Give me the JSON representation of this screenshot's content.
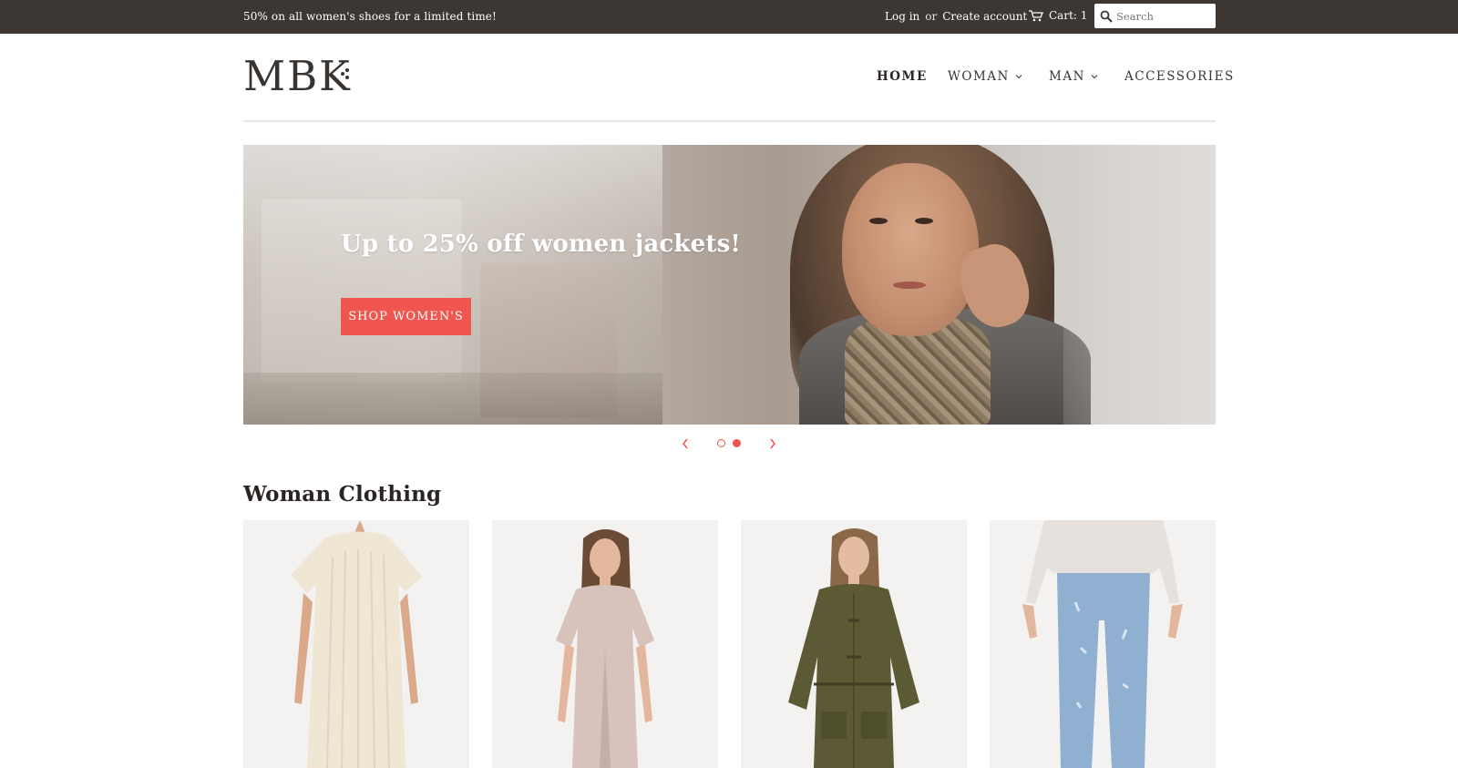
{
  "topbar": {
    "announcement": "50% on all women's shoes for a limited time!",
    "login": "Log in",
    "or": "or",
    "create_account": "Create account",
    "cart": "Cart: 1",
    "search_placeholder": "Search"
  },
  "header": {
    "logo": "MBK",
    "nav": [
      {
        "label": "HOME",
        "active": true
      },
      {
        "label": "WOMAN",
        "dropdown": true
      },
      {
        "label": "MAN",
        "dropdown": true
      },
      {
        "label": "ACCESSORIES"
      }
    ]
  },
  "hero": {
    "heading": "Up to 25% off women jackets!",
    "button": "SHOP WOMEN'S",
    "slides": 2,
    "active_slide": 2
  },
  "section": {
    "title": "Woman Clothing"
  },
  "colors": {
    "topbar_bg": "#3d3733",
    "accent": "#f0564f",
    "text": "#2f2a26"
  }
}
